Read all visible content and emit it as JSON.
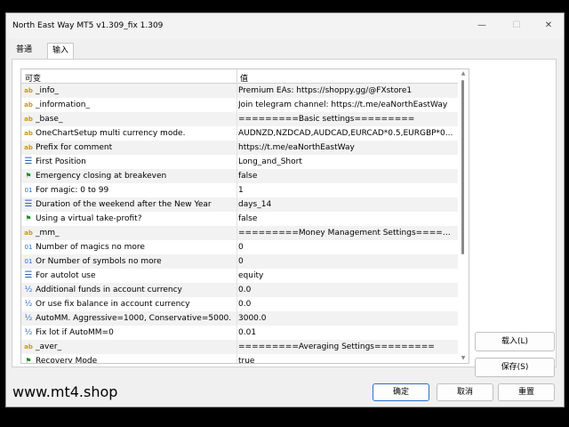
{
  "window": {
    "title": "North East Way MT5 v1.309_fix 1.309",
    "minimize_glyph": "—",
    "maximize_glyph": "☐",
    "close_glyph": "✕"
  },
  "tabs": [
    {
      "label": "普通",
      "active": false
    },
    {
      "label": "输入",
      "active": true
    }
  ],
  "grid": {
    "col_variable": "可变",
    "col_value": "值",
    "rows": [
      {
        "icon": "ab",
        "name": "_info_",
        "value": "Premium EAs: https://shoppy.gg/@FXstore1"
      },
      {
        "icon": "ab",
        "name": "_information_",
        "value": "Join telegram channel: https://t.me/eaNorthEastWay"
      },
      {
        "icon": "ab",
        "name": "_base_",
        "value": "=========Basic settings========="
      },
      {
        "icon": "ab",
        "name": "OneChartSetup multi currency mode.",
        "value": "AUDNZD,NZDCAD,AUDCAD,EURCAD*0.5,EURGBP*0..."
      },
      {
        "icon": "ab",
        "name": "Prefix for comment",
        "value": "https://t.me/eaNorthEastWay"
      },
      {
        "icon": "enum",
        "name": "First Position",
        "value": "Long_and_Short"
      },
      {
        "icon": "flag",
        "name": "Emergency closing at breakeven",
        "value": "false"
      },
      {
        "icon": "num",
        "name": "For magic: 0 to 99",
        "value": "1"
      },
      {
        "icon": "enum",
        "name": "Duration of the weekend after the New Year",
        "value": "days_14"
      },
      {
        "icon": "flag",
        "name": "Using a virtual take-profit?",
        "value": "false"
      },
      {
        "icon": "ab",
        "name": "_mm_",
        "value": "=========Money Management Settings=====..."
      },
      {
        "icon": "num",
        "name": "Number of magics no more",
        "value": "0"
      },
      {
        "icon": "num",
        "name": "Or Number of symbols no more",
        "value": "0"
      },
      {
        "icon": "enum",
        "name": "For autolot use",
        "value": "equity"
      },
      {
        "icon": "frac",
        "name": "Additional funds in account currency",
        "value": "0.0"
      },
      {
        "icon": "frac",
        "name": "Or use fix balance in account currency",
        "value": "0.0"
      },
      {
        "icon": "frac",
        "name": "AutoMM. Aggressive=1000, Conservative=5000.",
        "value": "3000.0"
      },
      {
        "icon": "frac",
        "name": "Fix lot if AutoMM=0",
        "value": "0.01"
      },
      {
        "icon": "ab",
        "name": "_aver_",
        "value": "=========Averaging Settings========="
      },
      {
        "icon": "flag",
        "name": "Recovery Mode",
        "value": "true"
      }
    ]
  },
  "icon_glyphs": {
    "ab": "ab",
    "num": "01",
    "frac": "½",
    "flag": "⚑",
    "enum": "☰"
  },
  "buttons": {
    "load": "载入(L)",
    "save": "保存(S)",
    "ok": "确定",
    "cancel": "取消",
    "reset": "重置"
  },
  "footer": {
    "watermark": "www.mt4.shop"
  }
}
